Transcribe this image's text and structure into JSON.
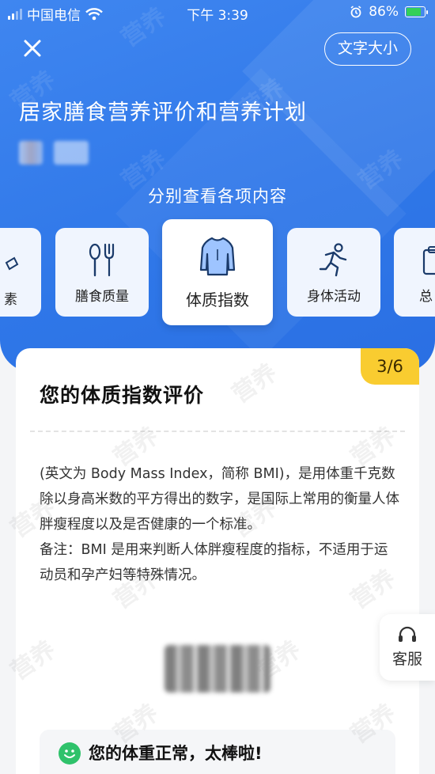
{
  "status_bar": {
    "carrier": "中国电信",
    "time": "下午 3:39",
    "battery": "86%",
    "battery_level": 0.86
  },
  "header": {
    "close_icon": "close-icon",
    "font_size_button": "文字大小",
    "title": "居家膳食营养评价和营养计划",
    "subtitle": "分别查看各项内容"
  },
  "tabs": [
    {
      "label": "素",
      "icon": "nutrient-icon",
      "active": false
    },
    {
      "label": "膳食质量",
      "icon": "fork-knife-icon",
      "active": false
    },
    {
      "label": "体质指数",
      "icon": "body-icon",
      "active": true
    },
    {
      "label": "身体活动",
      "icon": "running-icon",
      "active": false
    },
    {
      "label": "总",
      "icon": "clipboard-icon",
      "active": false
    }
  ],
  "card": {
    "step": "3/6",
    "title": "您的体质指数评价",
    "description": "(英文为 Body Mass Index，简称 BMI)，是用体重千克数除以身高米数的平方得出的数字，是国际上常用的衡量人体胖瘦程度以及是否健康的一个标准。",
    "note": "备注：BMI 是用来判断人体胖瘦程度的指标，不适用于运动员和孕产妇等特殊情况。",
    "result_text": "您的体重正常，太棒啦!"
  },
  "service": {
    "label": "客服",
    "icon": "headset-icon"
  },
  "watermark": "营养",
  "colors": {
    "header_blue": "#2f77e8",
    "badge_yellow": "#f9cc30",
    "success_green": "#2fc26b"
  }
}
